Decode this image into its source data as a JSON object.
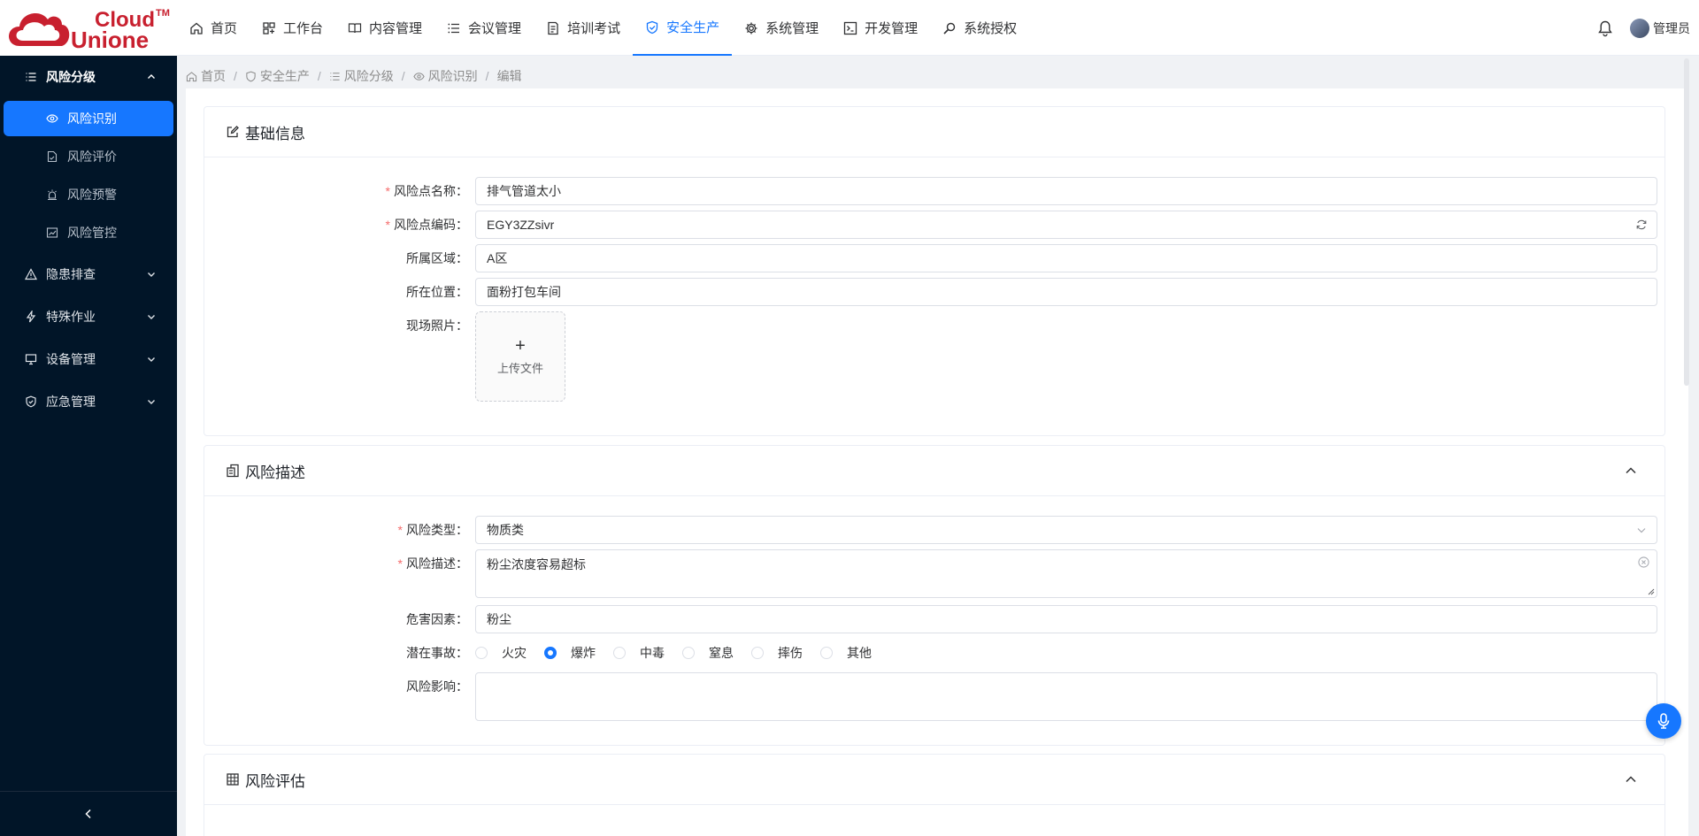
{
  "brand": {
    "line1": "Cloud",
    "line2": "Unione",
    "tm": "TM"
  },
  "nav": [
    {
      "label": "首页",
      "icon": "home-icon",
      "active": false
    },
    {
      "label": "工作台",
      "icon": "workbench-icon",
      "active": false
    },
    {
      "label": "内容管理",
      "icon": "book-icon",
      "active": false
    },
    {
      "label": "会议管理",
      "icon": "list-icon",
      "active": false
    },
    {
      "label": "培训考试",
      "icon": "file-icon",
      "active": false
    },
    {
      "label": "安全生产",
      "icon": "shield-icon",
      "active": true
    },
    {
      "label": "系统管理",
      "icon": "gear-icon",
      "active": false
    },
    {
      "label": "开发管理",
      "icon": "terminal-icon",
      "active": false
    },
    {
      "label": "系统授权",
      "icon": "search-icon",
      "active": false
    }
  ],
  "user": {
    "name": "管理员"
  },
  "sidebar": {
    "group_open": {
      "label": "风险分级"
    },
    "subitems": [
      {
        "label": "风险识别",
        "active": true
      },
      {
        "label": "风险评价",
        "active": false
      },
      {
        "label": "风险预警",
        "active": false
      },
      {
        "label": "风险管控",
        "active": false
      }
    ],
    "groups": [
      {
        "label": "隐患排查"
      },
      {
        "label": "特殊作业"
      },
      {
        "label": "设备管理"
      },
      {
        "label": "应急管理"
      }
    ]
  },
  "breadcrumb": [
    "首页",
    "安全生产",
    "风险分级",
    "风险识别",
    "编辑"
  ],
  "basic": {
    "title": "基础信息",
    "name_label": "风险点名称",
    "name_value": "排气管道太小",
    "code_label": "风险点编码",
    "code_value": "EGY3ZZsivr",
    "area_label": "所属区域",
    "area_value": "A区",
    "location_label": "所在位置",
    "location_value": "面粉打包车间",
    "photo_label": "现场照片",
    "upload_label": "上传文件"
  },
  "desc": {
    "title": "风险描述",
    "type_label": "风险类型",
    "type_value": "物质类",
    "desc_label": "风险描述",
    "desc_value": "粉尘浓度容易超标",
    "hazard_label": "危害因素",
    "hazard_value": "粉尘",
    "accident_label": "潜在事故",
    "accidents": [
      {
        "label": "火灾",
        "checked": false
      },
      {
        "label": "爆炸",
        "checked": true
      },
      {
        "label": "中毒",
        "checked": false
      },
      {
        "label": "窒息",
        "checked": false
      },
      {
        "label": "摔伤",
        "checked": false
      },
      {
        "label": "其他",
        "checked": false
      }
    ],
    "impact_label": "风险影响",
    "impact_value": ""
  },
  "eval": {
    "title": "风险评估"
  },
  "colors": {
    "primary": "#1677ff",
    "sidebar_bg": "#011528",
    "required": "#f56c6c"
  }
}
